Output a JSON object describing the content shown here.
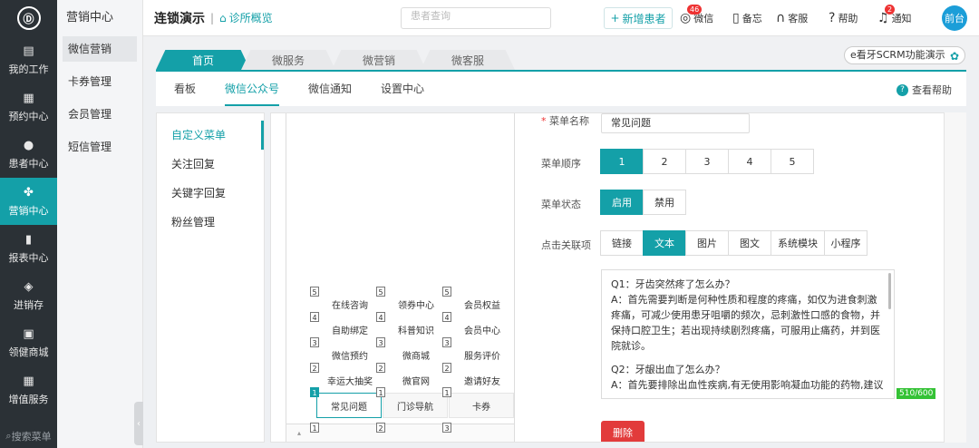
{
  "sidebar": {
    "logo": "Ⓓ",
    "items": [
      {
        "label": "我的工作",
        "icon": "chart-icon",
        "glyph": "▤"
      },
      {
        "label": "预约中心",
        "icon": "calendar-icon",
        "glyph": "▦"
      },
      {
        "label": "患者中心",
        "icon": "users-icon",
        "glyph": "●"
      },
      {
        "label": "营销中心",
        "icon": "marketing-icon",
        "glyph": "✤",
        "active": true
      },
      {
        "label": "报表中心",
        "icon": "bar-chart-icon",
        "glyph": "▮"
      },
      {
        "label": "进销存",
        "icon": "layers-icon",
        "glyph": "◈"
      },
      {
        "label": "领健商城",
        "icon": "shop-icon",
        "glyph": "▣"
      },
      {
        "label": "增值服务",
        "icon": "grid-icon",
        "glyph": "▦"
      }
    ],
    "search": "搜索菜单"
  },
  "submenu": {
    "title": "营销中心",
    "items": [
      "微信营销",
      "卡券管理",
      "会员管理",
      "短信管理"
    ]
  },
  "topbar": {
    "clinic": "连锁演示",
    "overview": "诊所概览",
    "search_placeholder": "患者查询",
    "new_patient": "新增患者",
    "wechat": "微信",
    "wechat_badge": "46",
    "memo": "备忘",
    "service": "客服",
    "help": "帮助",
    "notice": "通知",
    "notice_badge": "2",
    "avatar": "前台"
  },
  "tabs": [
    "首页",
    "微服务",
    "微营销",
    "微客服"
  ],
  "scrm": "e看牙SCRM功能演示",
  "subnav": {
    "items": [
      "看板",
      "微信公众号",
      "微信通知",
      "设置中心"
    ],
    "help": "查看帮助"
  },
  "left_menu": [
    "自定义菜单",
    "关注回复",
    "关键字回复",
    "粉丝管理"
  ],
  "phone_menu": {
    "columns": [
      {
        "main": "常见问题",
        "main_num": "1",
        "subs": [
          {
            "label": "在线咨询",
            "num": "5"
          },
          {
            "label": "自助绑定",
            "num": "4"
          },
          {
            "label": "微信预约",
            "num": "3"
          },
          {
            "label": "幸运大抽奖",
            "num": "2"
          }
        ],
        "bottom_num": "1"
      },
      {
        "main": "门诊导航",
        "main_num": "1",
        "subs": [
          {
            "label": "领券中心",
            "num": "5"
          },
          {
            "label": "科普知识",
            "num": "4"
          },
          {
            "label": "微商城",
            "num": "3"
          },
          {
            "label": "微官网",
            "num": "2"
          }
        ],
        "bottom_num": "2"
      },
      {
        "main": "卡券",
        "main_num": "1",
        "subs": [
          {
            "label": "会员权益",
            "num": "5"
          },
          {
            "label": "会员中心",
            "num": "4"
          },
          {
            "label": "服务评价",
            "num": "3"
          },
          {
            "label": "邀请好友",
            "num": "2"
          }
        ],
        "bottom_num": "3"
      }
    ]
  },
  "form": {
    "name_label": "菜单名称",
    "name_value": "常见问题",
    "order_label": "菜单顺序",
    "order_options": [
      "1",
      "2",
      "3",
      "4",
      "5"
    ],
    "order_selected": "1",
    "status_label": "菜单状态",
    "status_options": [
      "启用",
      "禁用"
    ],
    "status_selected": "启用",
    "link_label": "点击关联项",
    "link_options": [
      "链接",
      "文本",
      "图片",
      "图文",
      "系统模块",
      "小程序"
    ],
    "link_selected": "文本",
    "text": [
      "Q1：牙齿突然疼了怎么办？",
      "A：首先需要判断是何种性质和程度的疼痛，如仅为进食刺激疼痛，可减少使用患牙咀嚼的频次，忌刺激性口感的食物，并保持口腔卫生；若出现持续剧烈疼痛，可服用止痛药，并到医院就诊。",
      "Q2：牙龈出血了怎么办？",
      "A：首先要排除出血性疾病,有无使用影响凝血功能的药物,建议"
    ],
    "counter": "510/600",
    "delete": "删除"
  }
}
